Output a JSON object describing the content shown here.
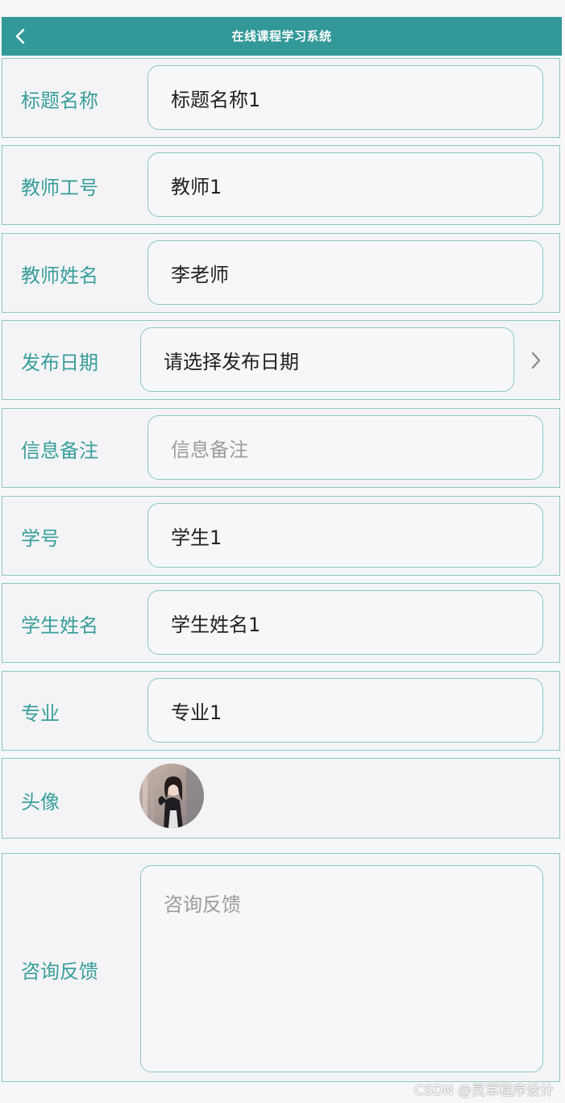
{
  "header": {
    "title": "在线课程学习系统",
    "back_icon": "chevron-left-icon"
  },
  "form": {
    "title_name": {
      "label": "标题名称",
      "value": "标题名称1"
    },
    "teacher_id": {
      "label": "教师工号",
      "value": "教师1"
    },
    "teacher_name": {
      "label": "教师姓名",
      "value": "李老师"
    },
    "publish_date": {
      "label": "发布日期",
      "placeholder": "请选择发布日期",
      "chevron_icon": "chevron-right-icon"
    },
    "info_note": {
      "label": "信息备注",
      "placeholder": "信息备注"
    },
    "student_id": {
      "label": "学号",
      "value": "学生1"
    },
    "student_name": {
      "label": "学生姓名",
      "value": "学生姓名1"
    },
    "major": {
      "label": "专业",
      "value": "专业1"
    },
    "avatar": {
      "label": "头像"
    },
    "feedback": {
      "label": "咨询反馈",
      "placeholder": "咨询反馈"
    }
  },
  "watermark": "CSDN @灵军程序设计",
  "colors": {
    "accent": "#339898",
    "label": "#3a9e9a",
    "border": "#8cc7c4"
  }
}
